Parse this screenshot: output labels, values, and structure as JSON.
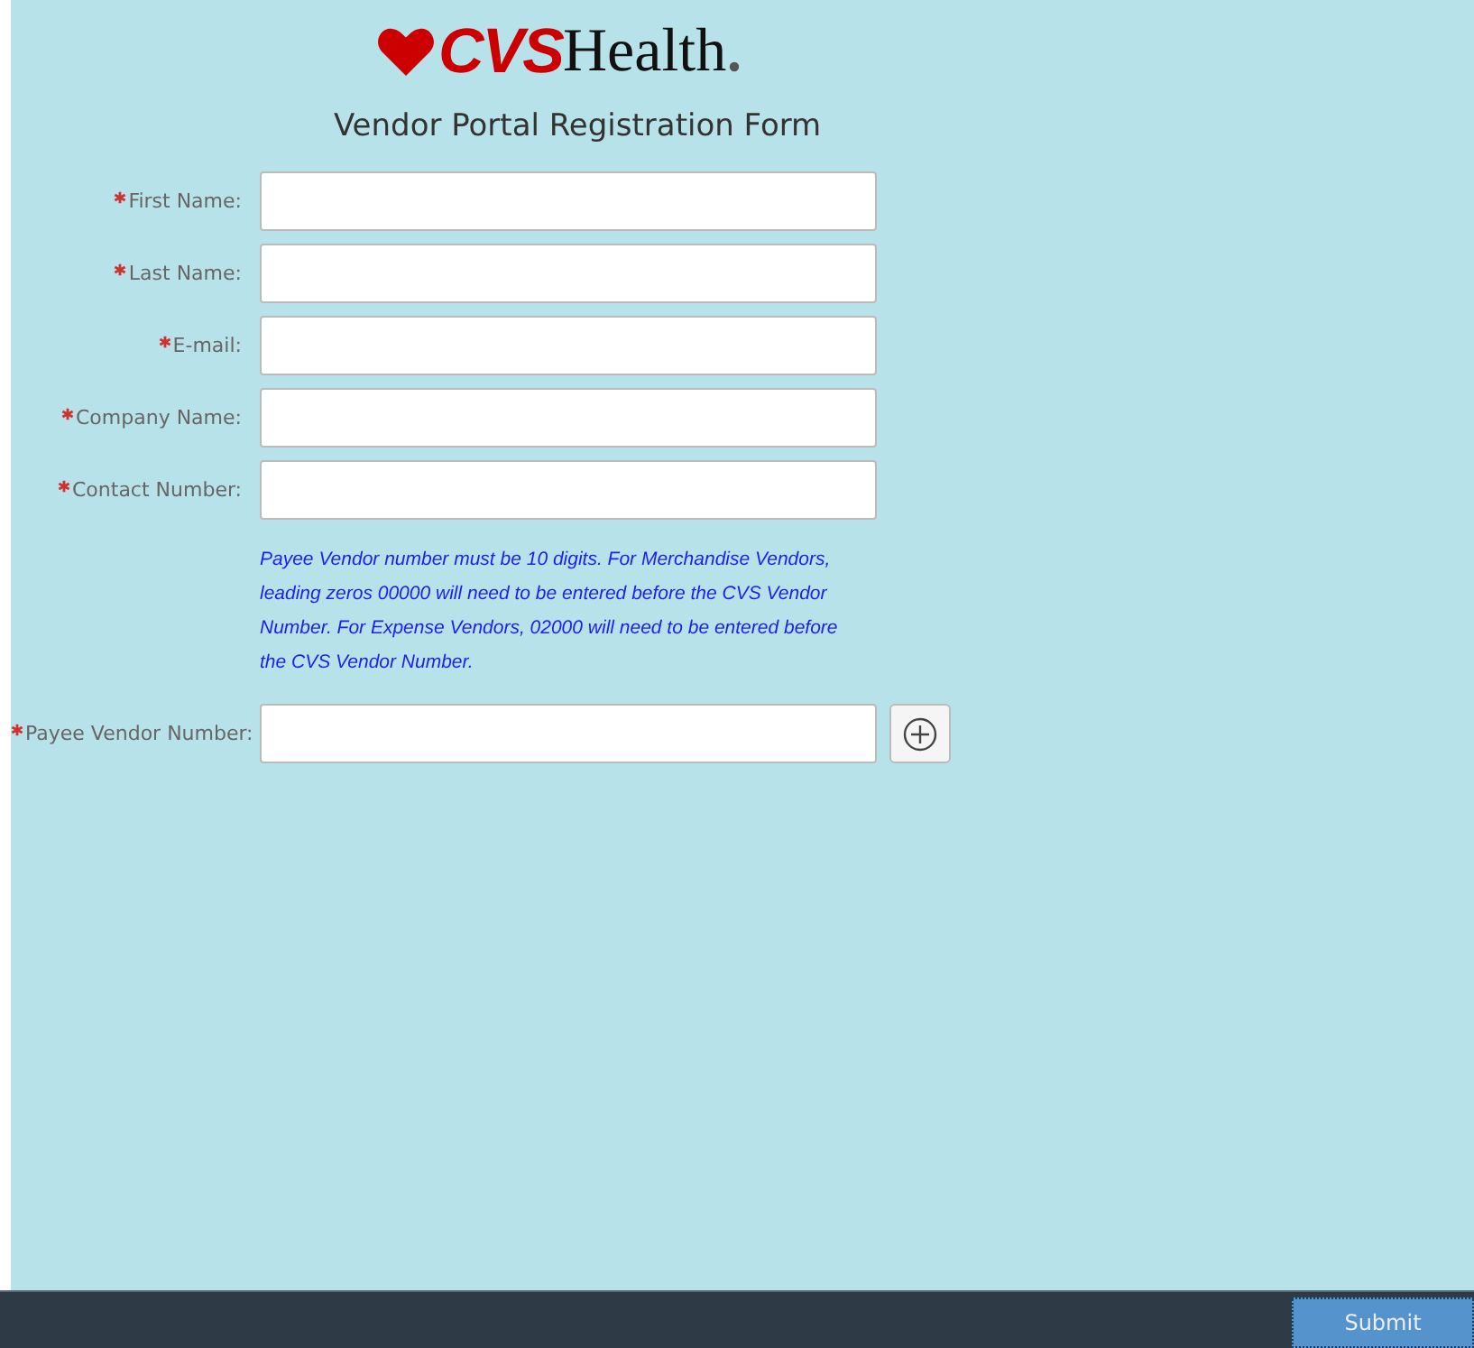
{
  "logo": {
    "brand": "CVS",
    "suffix": "Health"
  },
  "title": "Vendor Portal Registration Form",
  "fields": [
    {
      "label": "First Name:",
      "required": true
    },
    {
      "label": "Last Name:",
      "required": true
    },
    {
      "label": "E-mail:",
      "required": true
    },
    {
      "label": "Company Name:",
      "required": true
    },
    {
      "label": "Contact Number:",
      "required": true
    }
  ],
  "note": "Payee Vendor number must be 10 digits. For Merchandise Vendors, leading zeros 00000 will need to be entered before the CVS Vendor Number. For Expense Vendors, 02000 will need to be entered before the CVS Vendor Number.",
  "payee_field": {
    "label": "Payee Vendor Number:",
    "required": true
  },
  "footer": {
    "submit": "Submit"
  }
}
